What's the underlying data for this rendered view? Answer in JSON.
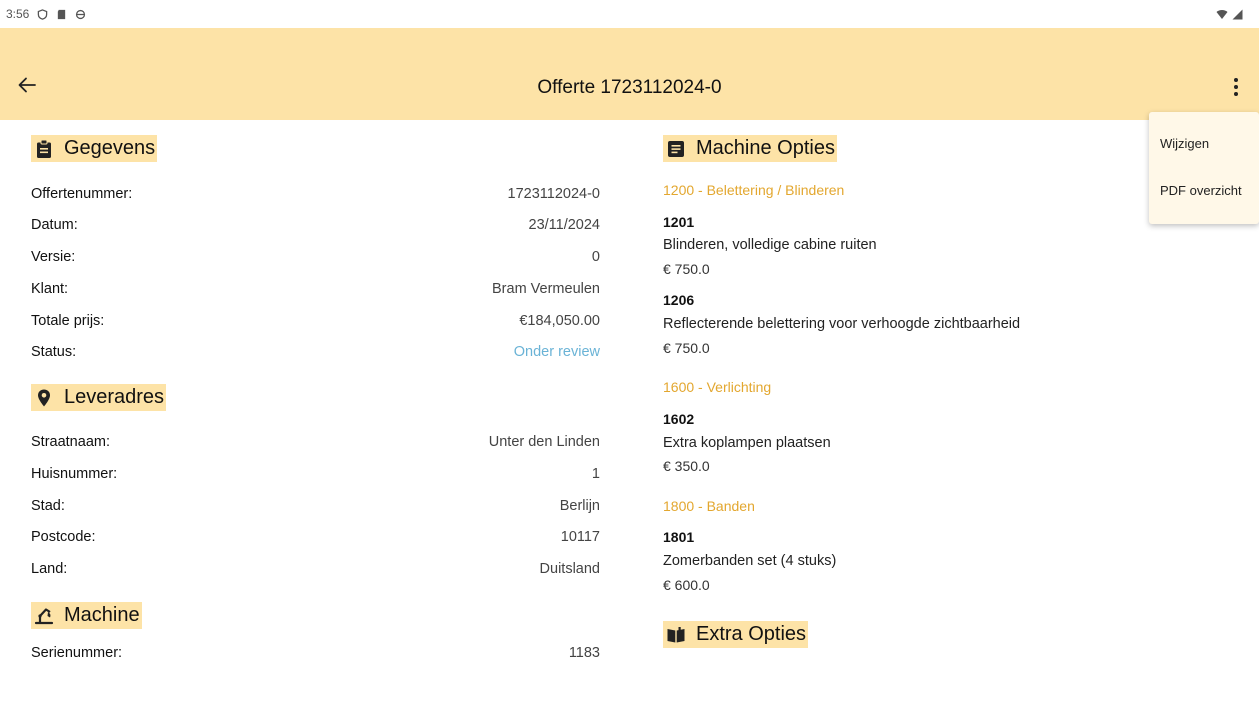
{
  "status_bar": {
    "time": "3:56"
  },
  "app_bar": {
    "title": "Offerte 1723112024-0"
  },
  "menu": {
    "items": [
      "Wijzigen",
      "PDF overzicht"
    ]
  },
  "gegevens": {
    "title": "Gegevens",
    "rows": [
      {
        "label": "Offertenummer:",
        "value": "1723112024-0"
      },
      {
        "label": "Datum:",
        "value": "23/11/2024"
      },
      {
        "label": "Versie:",
        "value": "0"
      },
      {
        "label": "Klant:",
        "value": "Bram Vermeulen"
      },
      {
        "label": "Totale prijs:",
        "value": "€184,050.00"
      },
      {
        "label": "Status:",
        "value": "Onder review"
      }
    ]
  },
  "leveradres": {
    "title": "Leveradres",
    "rows": [
      {
        "label": "Straatnaam:",
        "value": "Unter den Linden"
      },
      {
        "label": "Huisnummer:",
        "value": "1"
      },
      {
        "label": "Stad:",
        "value": "Berlijn"
      },
      {
        "label": "Postcode:",
        "value": "10117"
      },
      {
        "label": "Land:",
        "value": "Duitsland"
      }
    ]
  },
  "machine": {
    "title": "Machine",
    "rows": [
      {
        "label": "Serienummer:",
        "value": "1183"
      }
    ]
  },
  "machine_opties": {
    "title": "Machine Opties",
    "groups": [
      {
        "title": "1200 - Belettering / Blinderen",
        "options": [
          {
            "code": "1201",
            "description": "Blinderen, volledige cabine ruiten",
            "price": "€ 750.0"
          },
          {
            "code": "1206",
            "description": "Reflecterende belettering voor verhoogde zichtbaarheid",
            "price": "€ 750.0"
          }
        ]
      },
      {
        "title": "1600 - Verlichting",
        "options": [
          {
            "code": "1602",
            "description": "Extra koplampen plaatsen",
            "price": "€ 350.0"
          }
        ]
      },
      {
        "title": "1800 - Banden",
        "options": [
          {
            "code": "1801",
            "description": "Zomerbanden set (4 stuks)",
            "price": "€ 600.0"
          }
        ]
      }
    ]
  },
  "extra_opties": {
    "title": "Extra Opties"
  },
  "colors": {
    "accent": "#fde3a7",
    "group_title": "#e3a72f",
    "status": "#6ab3d6"
  }
}
